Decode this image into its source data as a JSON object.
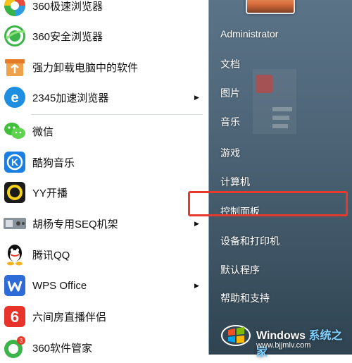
{
  "programs": [
    {
      "label": "360极速浏览器",
      "icon": "360-speed-browser-icon",
      "has_arrow": false
    },
    {
      "label": "360安全浏览器",
      "icon": "360-safe-browser-icon",
      "has_arrow": false
    },
    {
      "label": "强力卸载电脑中的软件",
      "icon": "uninstaller-icon",
      "has_arrow": false
    },
    {
      "label": "2345加速浏览器",
      "icon": "2345-browser-icon",
      "has_arrow": true
    },
    {
      "label": "微信",
      "icon": "wechat-icon",
      "has_arrow": false
    },
    {
      "label": "酷狗音乐",
      "icon": "kugou-music-icon",
      "has_arrow": false
    },
    {
      "label": "YY开播",
      "icon": "yy-live-icon",
      "has_arrow": false
    },
    {
      "label": "胡杨专用SEQ机架",
      "icon": "seq-rack-icon",
      "has_arrow": true
    },
    {
      "label": "腾讯QQ",
      "icon": "qq-penguin-icon",
      "has_arrow": false
    },
    {
      "label": "WPS Office",
      "icon": "wps-office-icon",
      "has_arrow": true
    },
    {
      "label": "六间房直播伴侣",
      "icon": "liujianfang-icon",
      "has_arrow": false
    },
    {
      "label": "360软件管家",
      "icon": "360-software-manager-icon",
      "has_arrow": false
    }
  ],
  "arrow_glyph": "▶",
  "right_pane": {
    "user": "Administrator",
    "items": [
      "文档",
      "图片",
      "音乐",
      "游戏",
      "计算机",
      "控制面板",
      "设备和打印机",
      "默认程序",
      "帮助和支持"
    ]
  },
  "watermark": {
    "brand_en": "Windows",
    "brand_cn": "系统之家",
    "url": "www.bjjmlv.com"
  },
  "colors": {
    "highlight": "#e83a2c",
    "right_pane_top": "#5b7387",
    "right_pane_bottom": "#2f4351"
  }
}
